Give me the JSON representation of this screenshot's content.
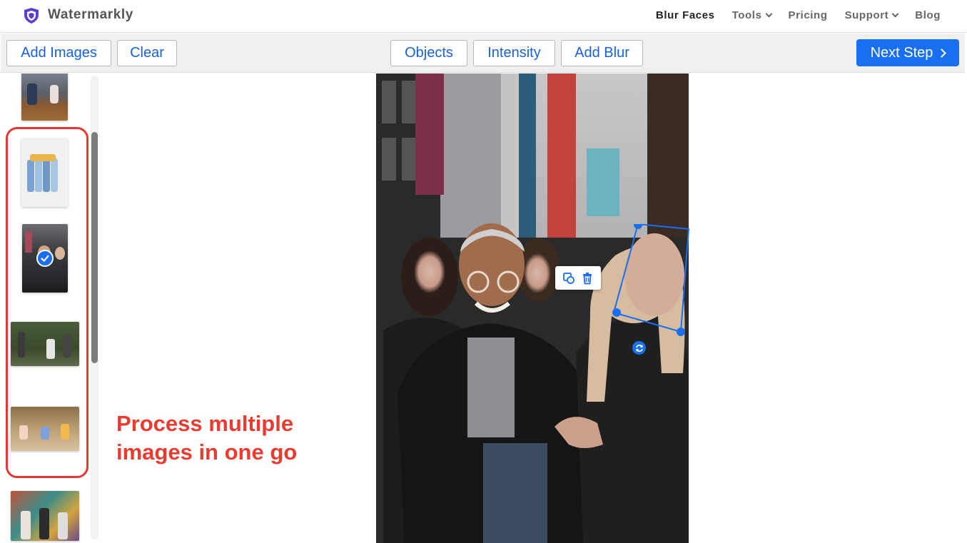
{
  "nav": {
    "brand": "Watermarkly",
    "links": [
      {
        "label": "Blur Faces",
        "active": true,
        "dropdown": false
      },
      {
        "label": "Tools",
        "active": false,
        "dropdown": true
      },
      {
        "label": "Pricing",
        "active": false,
        "dropdown": false
      },
      {
        "label": "Support",
        "active": false,
        "dropdown": true
      },
      {
        "label": "Blog",
        "active": false,
        "dropdown": false
      }
    ]
  },
  "toolbar": {
    "add_images": "Add Images",
    "clear": "Clear",
    "objects": "Objects",
    "intensity": "Intensity",
    "add_blur": "Add Blur",
    "next_step": "Next Step"
  },
  "annotation": {
    "line1": "Process multiple",
    "line2": "images in one go"
  },
  "colors": {
    "accent": "#1a6ff0",
    "button_text": "#1a62d8",
    "annotation": "#ea3b30"
  },
  "icons": [
    "shield-logo-icon",
    "chevron-down-icon",
    "chevron-right-icon",
    "checkmark-icon",
    "duplicate-icon",
    "trash-icon",
    "rotate-icon"
  ]
}
